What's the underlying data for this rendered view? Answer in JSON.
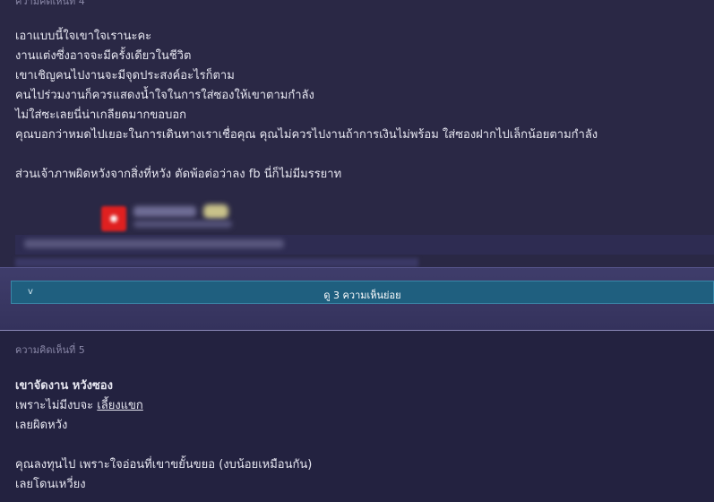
{
  "comment4": {
    "number_label": "ความคิดเห็นที่ 4",
    "lines": [
      "เอาแบบนี้ใจเขาใจเรานะคะ",
      "งานแต่งซึ่งอาจจะมีครั้งเดียวในชีวิต",
      "เขาเชิญคนไปงานจะมีจุดประสงค์อะไรก็ตาม",
      "คนไปร่วมงานก็ควรแสดงน้ำใจในการใส่ซองให้เขาตามกำลัง",
      "ไม่ใส่ซะเลยนี่น่าเกลียดมากขอบอก",
      "คุณบอกว่าหมดไปเยอะในการเดินทางเราเชื่อคุณ คุณไม่ควรไปงานถ้าการเงินไม่พร้อม ใส่ซองฝากไปเล็กน้อยตามกำลัง",
      "ส่วนเจ้าภาพผิดหวังจากสิ่งที่หวัง ตัดพ้อต่อว่าลง fb นี่ก็ไม่มีมรรยาท"
    ]
  },
  "expand": {
    "chevron": "v",
    "label": "ดู 3 ความเห็นย่อย"
  },
  "comment5": {
    "number_label": "ความคิดเห็นที่ 5",
    "line1_a": "เขาจัดงาน ",
    "line1_b": "หวังซอง",
    "line2_a": "เพราะไม่มีงบจะ ",
    "line2_b": "เลี้ยงแขก",
    "line3": "เลยผิดหวัง",
    "line4": "คุณลงทุนไป เพราะใจอ่อนที่เขาขยั้นขยอ (งบน้อยเหมือนกัน)",
    "line5": "เลยโดนเหวี่ยง"
  },
  "colors": {
    "background": "#2a2845",
    "button": "#1f5f7f",
    "text": "#e6e6f0",
    "muted": "#8a88a8"
  }
}
